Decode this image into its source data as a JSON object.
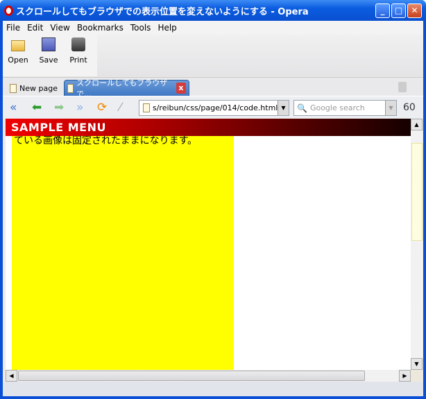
{
  "window": {
    "title": "スクロールしてもブラウザでの表示位置を変えないようにする - Opera"
  },
  "menu": [
    "File",
    "Edit",
    "View",
    "Bookmarks",
    "Tools",
    "Help"
  ],
  "toolbar": {
    "open": "Open",
    "save": "Save",
    "print": "Print"
  },
  "tabs": {
    "new_page": "New page",
    "active": "スクロールしてもブラウザで..."
  },
  "address": {
    "url": "s/reibun/css/page/014/code.html",
    "search_placeholder": "Google search"
  },
  "page": {
    "header": "SAMPLE MENU",
    "text": "ている画像は固定されたままになります。"
  },
  "colors": {
    "yellow": "#ffff00",
    "header_start": "#f00000",
    "header_end": "#150000"
  }
}
